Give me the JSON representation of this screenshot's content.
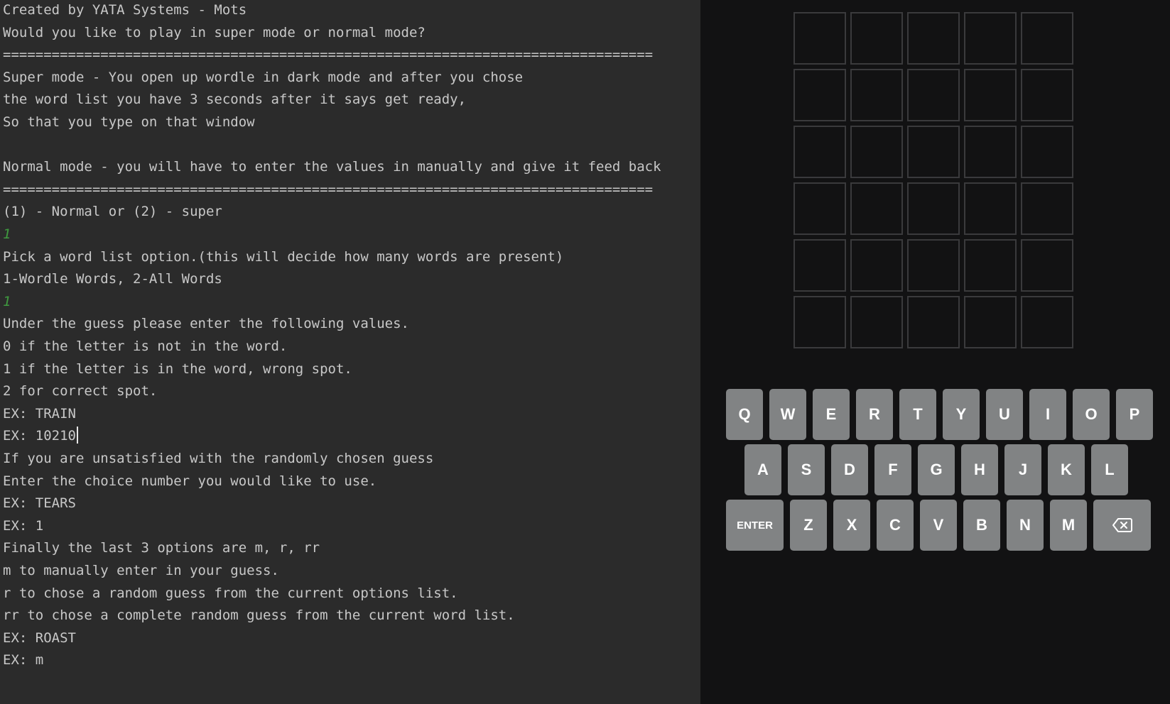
{
  "terminal": {
    "lines": [
      "Created by YATA Systems - Mots",
      "Would you like to play in super mode or normal mode?",
      "================================================================================",
      "Super mode - You open up wordle in dark mode and after you chose",
      "the word list you have 3 seconds after it says get ready,",
      "So that you type on that window",
      "",
      "Normal mode - you will have to enter the values in manually and give it feed back",
      "================================================================================",
      "(1) - Normal or (2) - super",
      "1",
      "Pick a word list option.(this will decide how many words are present)",
      "1-Wordle Words, 2-All Words",
      "1",
      "Under the guess please enter the following values.",
      "0 if the letter is not in the word.",
      "1 if the letter is in the word, wrong spot.",
      "2 for correct spot.",
      "EX: TRAIN",
      "EX: 10210",
      "If you are unsatisfied with the randomly chosen guess",
      "Enter the choice number you would like to use.",
      "EX: TEARS",
      "EX: 1",
      "Finally the last 3 options are m, r, rr",
      "m to manually enter in your guess.",
      "r to chose a random guess from the current options list.",
      "rr to chose a complete random guess from the current word list.",
      "EX: ROAST",
      "EX: m"
    ],
    "input_line_indices": [
      10,
      13
    ],
    "caret_line_index": 19
  },
  "wordle": {
    "board": {
      "rows": 6,
      "cols": 5
    },
    "keyboard": {
      "row1": [
        "Q",
        "W",
        "E",
        "R",
        "T",
        "Y",
        "U",
        "I",
        "O",
        "P"
      ],
      "row2": [
        "A",
        "S",
        "D",
        "F",
        "G",
        "H",
        "J",
        "K",
        "L"
      ],
      "row3": [
        "ENTER",
        "Z",
        "X",
        "C",
        "V",
        "B",
        "N",
        "M",
        "backspace-icon"
      ]
    },
    "colors": {
      "background": "#121213",
      "tile_border": "#3a3a3c",
      "key": "#818384",
      "key_text": "#ffffff"
    }
  },
  "colors": {
    "terminal_background": "#2b2b2b",
    "terminal_text": "#c8c8c8",
    "terminal_input": "#3f9a3f"
  }
}
